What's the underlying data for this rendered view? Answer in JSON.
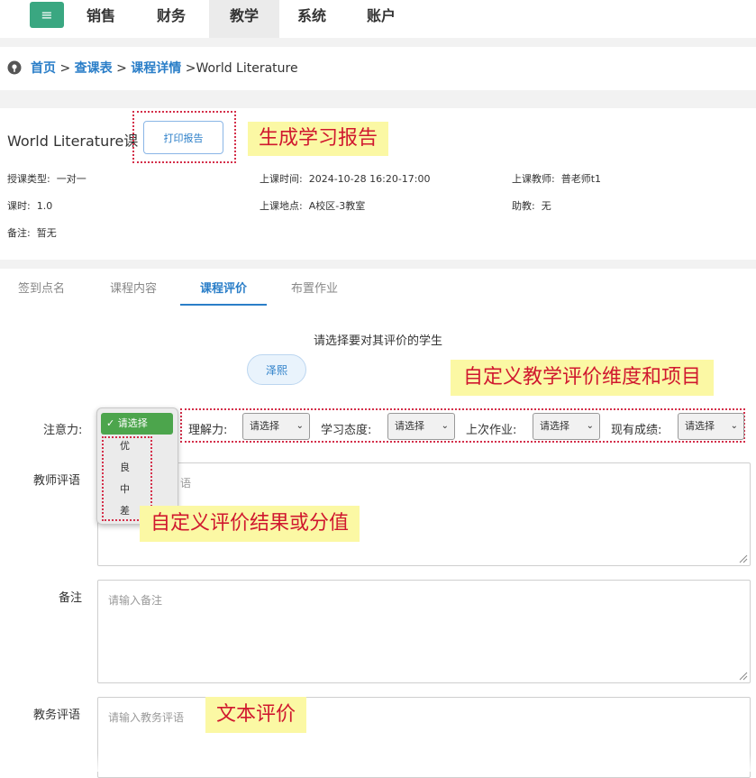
{
  "nav": {
    "menu_icon": "menu-icon",
    "items": [
      "销售",
      "财务",
      "教学",
      "系统",
      "账户"
    ],
    "active": "教学"
  },
  "breadcrumb": {
    "icon": "location-pin-icon",
    "links": [
      "首页",
      "查课表",
      "课程详情"
    ],
    "current": "World Literature"
  },
  "course": {
    "title": "World Literature课",
    "print_button": "打印报告",
    "fields": {
      "type_label": "授课类型:",
      "type_value": "一对一",
      "time_label": "上课时间:",
      "time_value": "2024-10-28 16:20-17:00",
      "teacher_label": "上课教师:",
      "teacher_value": "普老师t1",
      "hours_label": "课时:",
      "hours_value": "1.0",
      "location_label": "上课地点:",
      "location_value": "A校区-3教室",
      "assistant_label": "助教:",
      "assistant_value": "无",
      "note_label": "备注:",
      "note_value": "暂无"
    }
  },
  "tabs": [
    "签到点名",
    "课程内容",
    "课程评价",
    "布置作业"
  ],
  "active_tab": "课程评价",
  "evaluation": {
    "prompt": "请选择要对其评价的学生",
    "student": "泽熙",
    "dimensions": [
      {
        "label": "注意力:",
        "value": "请选择"
      },
      {
        "label": "理解力:",
        "value": "请选择"
      },
      {
        "label": "学习态度:",
        "value": "请选择"
      },
      {
        "label": "上次作业:",
        "value": "请选择"
      },
      {
        "label": "现有成绩:",
        "value": "请选择"
      }
    ],
    "dropdown": {
      "selected": "✓ 请选择",
      "options": [
        "优",
        "良",
        "中",
        "差"
      ]
    },
    "teacher_comment_label": "教师评语",
    "teacher_comment_placeholder_tail": "语",
    "note_label": "备注",
    "note_placeholder": "请输入备注",
    "admin_comment_label": "教务评语",
    "admin_comment_placeholder": "请输入教务评语"
  },
  "callouts": {
    "report": "生成学习报告",
    "dimensions": "自定义教学评价维度和项目",
    "results": "自定义评价结果或分值",
    "text": "文本评价"
  },
  "colors": {
    "brand_green": "#3aa781",
    "link_blue": "#2a7ec8",
    "callout_bg": "#fbf8a4",
    "callout_text": "#d0182f",
    "highlight_border": "#d42f4a",
    "selected_option": "#4ca54c"
  }
}
